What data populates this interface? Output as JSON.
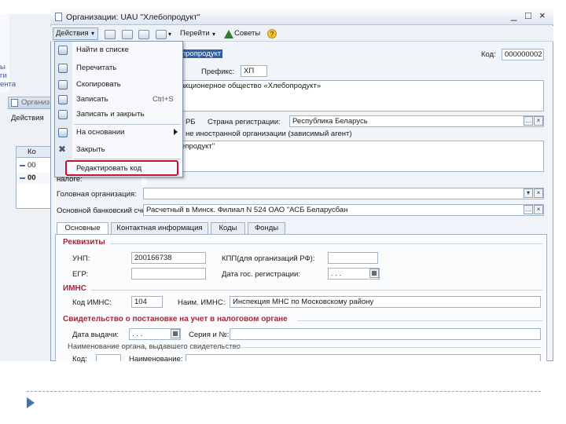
{
  "window": {
    "title": "Организации: UAU \"Хлебопродукт\"",
    "controls": [
      "_",
      "□",
      "×"
    ]
  },
  "toolbar": {
    "actions_label": "Действия",
    "goto_label": "Перейти",
    "tips_label": "Советы"
  },
  "context_menu": {
    "items": [
      {
        "label": "Найти в списке",
        "icon": "find-icon"
      },
      {
        "label": "Перечитать",
        "icon": "refresh-icon"
      },
      {
        "label": "Скопировать",
        "icon": "copy-icon"
      },
      {
        "label": "Записать",
        "shortcut": "Ctrl+S",
        "icon": "save-icon"
      },
      {
        "label": "Записать и закрыть",
        "icon": "save-close-icon"
      },
      {
        "label": "На основании",
        "icon": "based-on-icon"
      },
      {
        "label": "Закрыть",
        "icon": "close-x-icon"
      },
      {
        "label": "Редактировать код",
        "icon": ""
      }
    ]
  },
  "background_window": {
    "title": "Организ",
    "actions_label": "Действия",
    "column_header": "Ко",
    "rows": [
      "00",
      "00"
    ],
    "left_labels": [
      "ы",
      "ги",
      "ента"
    ]
  },
  "form": {
    "name_value": "пропродукт",
    "code_label": "Код:",
    "code_value": "000000002",
    "prefix_label": "Префикс:",
    "prefix_value": "ХП",
    "full_name_value": "акционерное общество «Хлебопродукт»",
    "resident_fragment": "РБ",
    "country_label": "Страна регистрации:",
    "country_value": "Республика Беларусь",
    "foreign_text": "не иностранной организации (зависимый агент)",
    "short_name_value": "епродукт\"",
    "tax_label": "налоге:",
    "parent_org_label": "Головная организация:",
    "bank_account_label": "Основной банковский счет:",
    "bank_account_value": "Расчетный в Минск. Филиал N 524 ОАО \"АСБ Беларусбан"
  },
  "tabs": [
    "Основные",
    "Контактная информация",
    "Коды",
    "Фонды"
  ],
  "sections": {
    "requisites": {
      "title": "Реквизиты",
      "unp_label": "УНП:",
      "unp_value": "200166738",
      "kpp_label": "КПП(для организаций РФ):",
      "egr_label": "ЕГР:",
      "reg_date_label": "Дата гос. регистрации:",
      "reg_date_value": ". . ."
    },
    "imns": {
      "title": "ИМНС",
      "code_label": "Код ИМНС:",
      "code_value": "104",
      "name_label": "Наим. ИМНС:",
      "name_value": "Инспекция МНС по Московскому району"
    },
    "certificate": {
      "title": "Свидетельство о постановке на учет в налоговом органе",
      "issue_date_label": "Дата выдачи:",
      "issue_date_value": ". . .",
      "series_label": "Серия и №:",
      "issuer_label": "Наименование органа, выдавшего свидетельство",
      "code_label": "Код:",
      "name_label": "Наименование:"
    }
  }
}
